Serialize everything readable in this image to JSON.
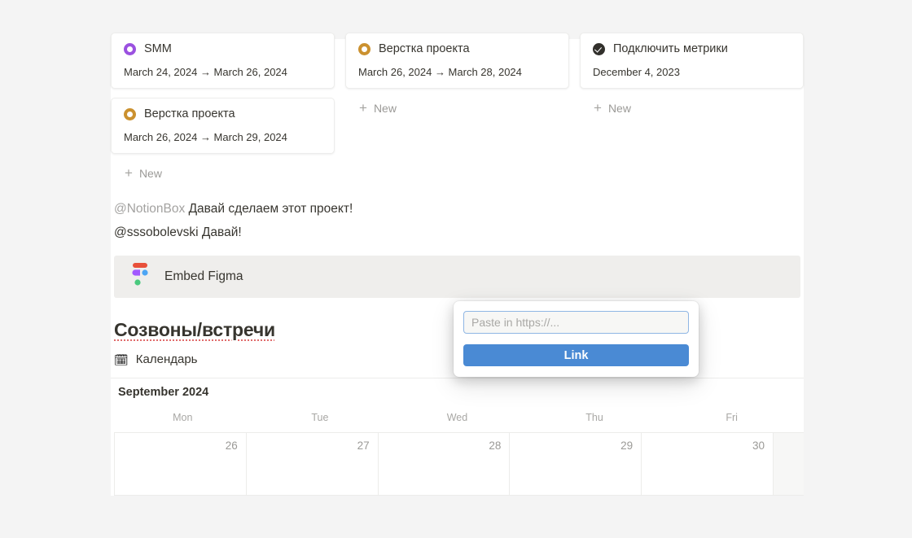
{
  "colors": {
    "page_bg": "#f4f4f4",
    "surface": "#ffffff",
    "text": "#37352f",
    "muted": "#9b9a97",
    "status_purple": "#9b51e0",
    "status_orange": "#cb912f",
    "status_done": "#32302c",
    "accent_button": "#4a8ad4",
    "input_focus_border": "#8fb6e4",
    "spellcheck_underline": "#e06c6c",
    "embed_bg": "#efeeec"
  },
  "board": {
    "new_label": "New",
    "columns": [
      {
        "cards": [
          {
            "title": "SMM",
            "icon": "status-ring-purple",
            "date": "March 24, 2024 → March 26, 2024"
          },
          {
            "title": "Верстка проекта",
            "icon": "status-ring-orange",
            "date": "March 26, 2024 → March 29, 2024"
          }
        ]
      },
      {
        "cards": [
          {
            "title": "Верстка проекта",
            "icon": "status-ring-orange",
            "date": "March 26, 2024 → March 28, 2024"
          }
        ]
      },
      {
        "cards": [
          {
            "title": "Подключить метрики",
            "icon": "status-check-done",
            "date": "December 4, 2023"
          }
        ]
      }
    ]
  },
  "comments": [
    {
      "mention": "@NotionBox",
      "mention_style": "gray",
      "text": "Давай сделаем этот проект!"
    },
    {
      "mention": "@sssobolevski",
      "mention_style": "dark",
      "text": "Давай!"
    }
  ],
  "embed": {
    "label": "Embed Figma",
    "icon": "figma-logo-icon"
  },
  "popup": {
    "input_value": "",
    "input_placeholder": "Paste in https://...",
    "button_label": "Link"
  },
  "section": {
    "heading": "Созвоны/встречи"
  },
  "calendar": {
    "view_icon": "calendar-icon",
    "view_label": "Календарь",
    "month": "September 2024",
    "weekdays": [
      "Mon",
      "Tue",
      "Wed",
      "Thu",
      "Fri"
    ],
    "days": [
      "26",
      "27",
      "28",
      "29",
      "30"
    ]
  }
}
